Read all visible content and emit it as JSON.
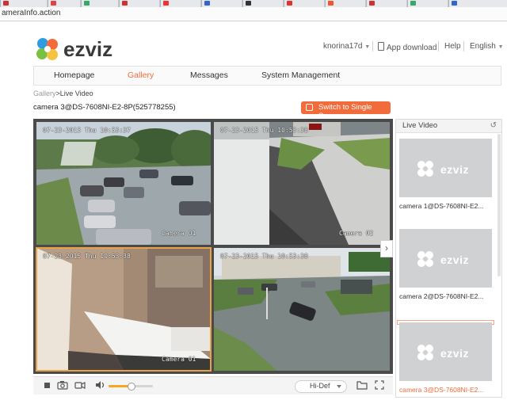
{
  "browser": {
    "url": "ameraInfo.action"
  },
  "header": {
    "brand": "ezviz",
    "username": "knorina17d",
    "app_download": "App download",
    "help": "Help",
    "language": "English"
  },
  "nav": {
    "items": [
      "Homepage",
      "Gallery",
      "Messages",
      "System Management"
    ],
    "active": "Gallery"
  },
  "breadcrumb": {
    "parent": "Gallery",
    "separator": ">",
    "current": "Live Video"
  },
  "camera_title": "camera 3@DS-7608NI-E2-8P(525778255)",
  "switch_button": "Switch to Single Screen",
  "feeds": [
    {
      "timestamp": "07-23-2015 Thu 10:53:37",
      "label": "Camera 01"
    },
    {
      "timestamp": "07-23-2015 Thu 10:53:38",
      "label": "Camera 02"
    },
    {
      "timestamp": "07-23-2015 Thu 10:53:38",
      "label": "Camera 01"
    },
    {
      "timestamp": "07-23-2015 Thu 10:53:38",
      "label": ""
    }
  ],
  "controls": {
    "quality": "Hi-Def",
    "volume_level": 0.5
  },
  "side_panel": {
    "title": "Live Video",
    "cameras": [
      {
        "label": "camera 1@DS-7608NI-E2...",
        "logo": "ezviz"
      },
      {
        "label": "camera 2@DS-7608NI-E2...",
        "logo": "ezviz"
      },
      {
        "label": "camera 3@DS-7608NI-E2...",
        "logo": "ezviz",
        "selected": true
      }
    ]
  },
  "colors": {
    "accent": "#f26b3a",
    "volume": "#f5a623"
  }
}
